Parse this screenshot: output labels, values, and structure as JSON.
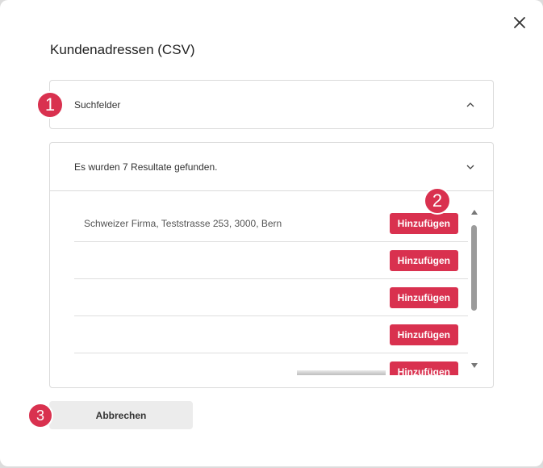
{
  "dialog": {
    "title": "Kundenadressen (CSV)",
    "close_icon": "close-icon"
  },
  "search_panel": {
    "label": "Suchfelder",
    "state": "collapsed-open-indicator",
    "icon": "chevron-up-icon"
  },
  "results_panel": {
    "summary": "Es wurden 7 Resultate gefunden.",
    "icon": "chevron-down-icon",
    "rows": [
      {
        "text": "Schweizer Firma, Teststrasse 253, 3000, Bern",
        "button": "Hinzufügen"
      },
      {
        "text": "",
        "button": "Hinzufügen"
      },
      {
        "text": "",
        "button": "Hinzufügen"
      },
      {
        "text": "",
        "button": "Hinzufügen"
      },
      {
        "text": "",
        "button": "Hinzufügen"
      }
    ]
  },
  "footer": {
    "cancel_label": "Abbrechen"
  },
  "markers": [
    "1",
    "2",
    "3"
  ],
  "colors": {
    "accent": "#d9314f",
    "cancel_bg": "#ececec"
  }
}
